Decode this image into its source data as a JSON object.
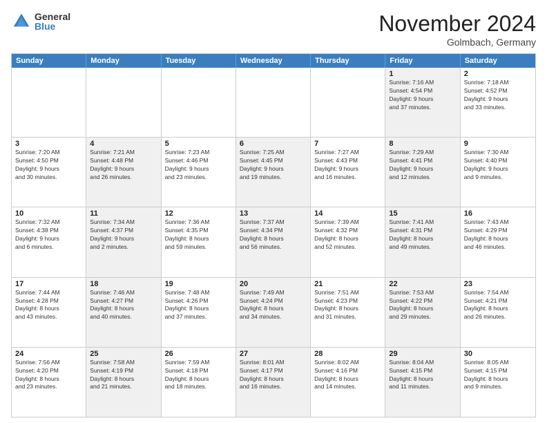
{
  "header": {
    "logo_general": "General",
    "logo_blue": "Blue",
    "month_title": "November 2024",
    "subtitle": "Golmbach, Germany"
  },
  "calendar": {
    "days_of_week": [
      "Sunday",
      "Monday",
      "Tuesday",
      "Wednesday",
      "Thursday",
      "Friday",
      "Saturday"
    ],
    "rows": [
      [
        {
          "day": "",
          "info": "",
          "shaded": false,
          "empty": true
        },
        {
          "day": "",
          "info": "",
          "shaded": false,
          "empty": true
        },
        {
          "day": "",
          "info": "",
          "shaded": false,
          "empty": true
        },
        {
          "day": "",
          "info": "",
          "shaded": false,
          "empty": true
        },
        {
          "day": "",
          "info": "",
          "shaded": false,
          "empty": true
        },
        {
          "day": "1",
          "info": "Sunrise: 7:16 AM\nSunset: 4:54 PM\nDaylight: 9 hours\nand 37 minutes.",
          "shaded": true
        },
        {
          "day": "2",
          "info": "Sunrise: 7:18 AM\nSunset: 4:52 PM\nDaylight: 9 hours\nand 33 minutes.",
          "shaded": false
        }
      ],
      [
        {
          "day": "3",
          "info": "Sunrise: 7:20 AM\nSunset: 4:50 PM\nDaylight: 9 hours\nand 30 minutes.",
          "shaded": false
        },
        {
          "day": "4",
          "info": "Sunrise: 7:21 AM\nSunset: 4:48 PM\nDaylight: 9 hours\nand 26 minutes.",
          "shaded": true
        },
        {
          "day": "5",
          "info": "Sunrise: 7:23 AM\nSunset: 4:46 PM\nDaylight: 9 hours\nand 23 minutes.",
          "shaded": false
        },
        {
          "day": "6",
          "info": "Sunrise: 7:25 AM\nSunset: 4:45 PM\nDaylight: 9 hours\nand 19 minutes.",
          "shaded": true
        },
        {
          "day": "7",
          "info": "Sunrise: 7:27 AM\nSunset: 4:43 PM\nDaylight: 9 hours\nand 16 minutes.",
          "shaded": false
        },
        {
          "day": "8",
          "info": "Sunrise: 7:29 AM\nSunset: 4:41 PM\nDaylight: 9 hours\nand 12 minutes.",
          "shaded": true
        },
        {
          "day": "9",
          "info": "Sunrise: 7:30 AM\nSunset: 4:40 PM\nDaylight: 9 hours\nand 9 minutes.",
          "shaded": false
        }
      ],
      [
        {
          "day": "10",
          "info": "Sunrise: 7:32 AM\nSunset: 4:38 PM\nDaylight: 9 hours\nand 6 minutes.",
          "shaded": false
        },
        {
          "day": "11",
          "info": "Sunrise: 7:34 AM\nSunset: 4:37 PM\nDaylight: 9 hours\nand 2 minutes.",
          "shaded": true
        },
        {
          "day": "12",
          "info": "Sunrise: 7:36 AM\nSunset: 4:35 PM\nDaylight: 8 hours\nand 59 minutes.",
          "shaded": false
        },
        {
          "day": "13",
          "info": "Sunrise: 7:37 AM\nSunset: 4:34 PM\nDaylight: 8 hours\nand 56 minutes.",
          "shaded": true
        },
        {
          "day": "14",
          "info": "Sunrise: 7:39 AM\nSunset: 4:32 PM\nDaylight: 8 hours\nand 52 minutes.",
          "shaded": false
        },
        {
          "day": "15",
          "info": "Sunrise: 7:41 AM\nSunset: 4:31 PM\nDaylight: 8 hours\nand 49 minutes.",
          "shaded": true
        },
        {
          "day": "16",
          "info": "Sunrise: 7:43 AM\nSunset: 4:29 PM\nDaylight: 8 hours\nand 46 minutes.",
          "shaded": false
        }
      ],
      [
        {
          "day": "17",
          "info": "Sunrise: 7:44 AM\nSunset: 4:28 PM\nDaylight: 8 hours\nand 43 minutes.",
          "shaded": false
        },
        {
          "day": "18",
          "info": "Sunrise: 7:46 AM\nSunset: 4:27 PM\nDaylight: 8 hours\nand 40 minutes.",
          "shaded": true
        },
        {
          "day": "19",
          "info": "Sunrise: 7:48 AM\nSunset: 4:26 PM\nDaylight: 8 hours\nand 37 minutes.",
          "shaded": false
        },
        {
          "day": "20",
          "info": "Sunrise: 7:49 AM\nSunset: 4:24 PM\nDaylight: 8 hours\nand 34 minutes.",
          "shaded": true
        },
        {
          "day": "21",
          "info": "Sunrise: 7:51 AM\nSunset: 4:23 PM\nDaylight: 8 hours\nand 31 minutes.",
          "shaded": false
        },
        {
          "day": "22",
          "info": "Sunrise: 7:53 AM\nSunset: 4:22 PM\nDaylight: 8 hours\nand 29 minutes.",
          "shaded": true
        },
        {
          "day": "23",
          "info": "Sunrise: 7:54 AM\nSunset: 4:21 PM\nDaylight: 8 hours\nand 26 minutes.",
          "shaded": false
        }
      ],
      [
        {
          "day": "24",
          "info": "Sunrise: 7:56 AM\nSunset: 4:20 PM\nDaylight: 8 hours\nand 23 minutes.",
          "shaded": false
        },
        {
          "day": "25",
          "info": "Sunrise: 7:58 AM\nSunset: 4:19 PM\nDaylight: 8 hours\nand 21 minutes.",
          "shaded": true
        },
        {
          "day": "26",
          "info": "Sunrise: 7:59 AM\nSunset: 4:18 PM\nDaylight: 8 hours\nand 18 minutes.",
          "shaded": false
        },
        {
          "day": "27",
          "info": "Sunrise: 8:01 AM\nSunset: 4:17 PM\nDaylight: 8 hours\nand 16 minutes.",
          "shaded": true
        },
        {
          "day": "28",
          "info": "Sunrise: 8:02 AM\nSunset: 4:16 PM\nDaylight: 8 hours\nand 14 minutes.",
          "shaded": false
        },
        {
          "day": "29",
          "info": "Sunrise: 8:04 AM\nSunset: 4:15 PM\nDaylight: 8 hours\nand 11 minutes.",
          "shaded": true
        },
        {
          "day": "30",
          "info": "Sunrise: 8:05 AM\nSunset: 4:15 PM\nDaylight: 8 hours\nand 9 minutes.",
          "shaded": false
        }
      ]
    ]
  }
}
